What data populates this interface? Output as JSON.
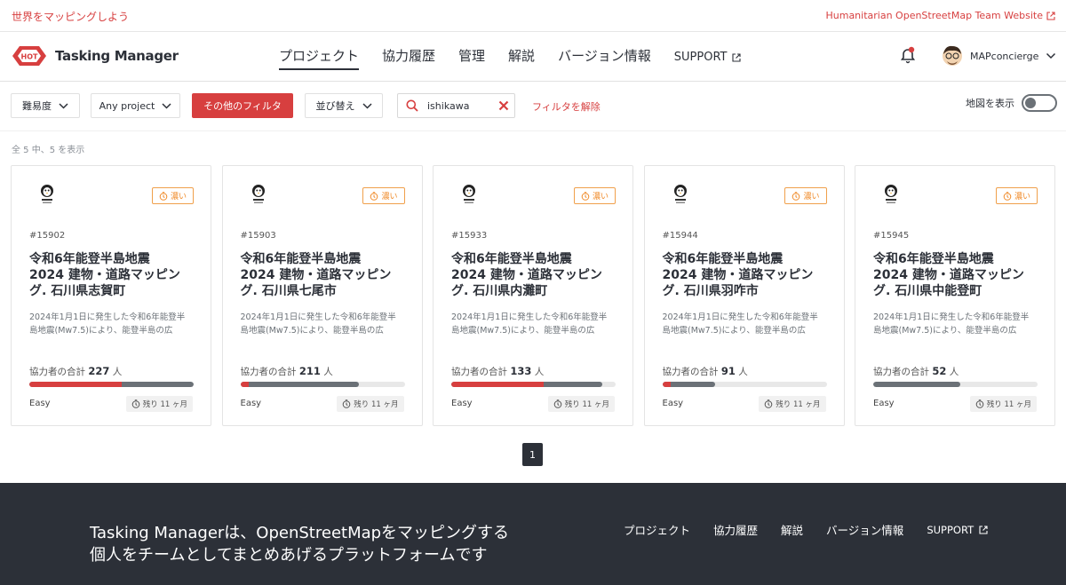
{
  "topbar": {
    "slogan": "世界をマッピングしよう",
    "hot_link": "Humanitarian OpenStreetMap Team Website"
  },
  "header": {
    "logo_badge": "HOT",
    "logo_text": "Tasking Manager",
    "nav": [
      "プロジェクト",
      "協力履歴",
      "管理",
      "解説",
      "バージョン情報"
    ],
    "support": "SUPPORT",
    "username": "MAPconcierge"
  },
  "filters": {
    "difficulty": "難易度",
    "project": "Any project",
    "more_filters": "その他のフィルタ",
    "sort": "並び替え",
    "search_value": "ishikawa",
    "clear": "フィルタを解除",
    "map_toggle": "地図を表示"
  },
  "result_count": "全 5 中、5 を表示",
  "projects": [
    {
      "id": "#15902",
      "urgency": "濃い",
      "title": "令和6年能登半島地震2024 建物・道路マッピング. 石川県志賀町",
      "desc": "2024年1月1日に発生した令和6年能登半島地震(Mw7.5)により、能登半島の広い...",
      "contrib_label": "協力者の合計",
      "contributors": "227",
      "contrib_unit": "人",
      "mapped": 0.56,
      "validated": 1.0,
      "difficulty": "Easy",
      "remaining": "残り 11 ヶ月"
    },
    {
      "id": "#15903",
      "urgency": "濃い",
      "title": "令和6年能登半島地震2024 建物・道路マッピング. 石川県七尾市",
      "desc": "2024年1月1日に発生した令和6年能登半島地震(Mw7.5)により、能登半島の広い...",
      "contrib_label": "協力者の合計",
      "contributors": "211",
      "contrib_unit": "人",
      "mapped": 0.05,
      "validated": 0.72,
      "difficulty": "Easy",
      "remaining": "残り 11 ヶ月"
    },
    {
      "id": "#15933",
      "urgency": "濃い",
      "title": "令和6年能登半島地震2024 建物・道路マッピング. 石川県内灘町",
      "desc": "2024年1月1日に発生した令和6年能登半島地震(Mw7.5)により、能登半島の広い...",
      "contrib_label": "協力者の合計",
      "contributors": "133",
      "contrib_unit": "人",
      "mapped": 0.56,
      "validated": 0.92,
      "difficulty": "Easy",
      "remaining": "残り 11 ヶ月"
    },
    {
      "id": "#15944",
      "urgency": "濃い",
      "title": "令和6年能登半島地震2024 建物・道路マッピング. 石川県羽咋市",
      "desc": "2024年1月1日に発生した令和6年能登半島地震(Mw7.5)により、能登半島の広い...",
      "contrib_label": "協力者の合計",
      "contributors": "91",
      "contrib_unit": "人",
      "mapped": 0.05,
      "validated": 0.32,
      "difficulty": "Easy",
      "remaining": "残り 11 ヶ月"
    },
    {
      "id": "#15945",
      "urgency": "濃い",
      "title": "令和6年能登半島地震2024 建物・道路マッピング. 石川県中能登町",
      "desc": "2024年1月1日に発生した令和6年能登半島地震(Mw7.5)により、能登半島の広い...",
      "contrib_label": "協力者の合計",
      "contributors": "52",
      "contrib_unit": "人",
      "mapped": 0.0,
      "validated": 0.53,
      "difficulty": "Easy",
      "remaining": "残り 11 ヶ月"
    }
  ],
  "pagination": {
    "current": "1"
  },
  "footer": {
    "tagline_1": "Tasking Managerは、OpenStreetMapをマッピングする",
    "tagline_2": "個人をチームとしてまとめあげるプラットフォームです",
    "nav": [
      "プロジェクト",
      "協力履歴",
      "解説",
      "バージョン情報"
    ],
    "support": "SUPPORT"
  },
  "colors": {
    "brand_red": "#d73f3f",
    "dark": "#2c3038",
    "urgency": "#f08c2c",
    "validated_bar": "#6b7177"
  },
  "icons": [
    "external-link-icon",
    "hot-logo-icon",
    "bell-icon",
    "avatar",
    "chevron-down-icon",
    "search-icon",
    "close-icon",
    "clock-icon",
    "organisation-logo-icon"
  ]
}
